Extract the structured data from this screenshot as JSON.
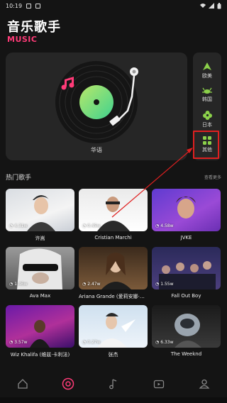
{
  "status": {
    "time": "10:19"
  },
  "header": {
    "title": "音乐歌手",
    "subtitle": "MUSIC"
  },
  "feature": {
    "label": "华语"
  },
  "regions": [
    {
      "label": "欧美",
      "icon": "arrow-up-icon"
    },
    {
      "label": "韩国",
      "icon": "crab-icon"
    },
    {
      "label": "日本",
      "icon": "flower-icon"
    },
    {
      "label": "其他",
      "icon": "grid-icon"
    }
  ],
  "section": {
    "title": "热门歌手",
    "more": "查看更多"
  },
  "artists": [
    {
      "name": "许嵩",
      "plays": "4.31w"
    },
    {
      "name": "Cristian Marchi",
      "plays": "0.45w"
    },
    {
      "name": "JVKE",
      "plays": "4.58w"
    },
    {
      "name": "Ava Max",
      "plays": "1.46w"
    },
    {
      "name": "Ariana Grande (爱莉安娜·格...",
      "plays": "2.47w"
    },
    {
      "name": "Fall Out Boy",
      "plays": "1.55w"
    },
    {
      "name": "Wiz Khalifa (维兹·卡利法)",
      "plays": "3.57w"
    },
    {
      "name": "张杰",
      "plays": "0.27w"
    },
    {
      "name": "The Weeknd",
      "plays": "6.33w"
    }
  ],
  "nav": [
    "home-icon",
    "disc-icon",
    "music-note-icon",
    "video-icon",
    "profile-icon"
  ],
  "colors": {
    "accent": "#ff3b78",
    "highlight": "#e02020",
    "region_icon": "#8bd14a"
  }
}
